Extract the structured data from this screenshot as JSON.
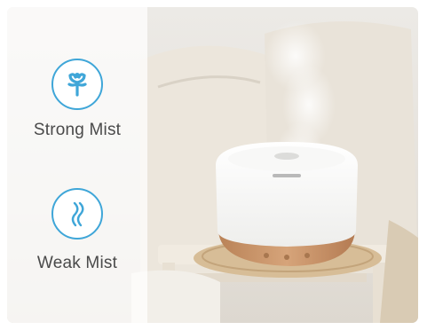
{
  "features": [
    {
      "label": "Strong Mist",
      "icon": "strong-mist-icon"
    },
    {
      "label": "Weak Mist",
      "icon": "weak-mist-icon"
    }
  ],
  "colors": {
    "accent": "#3fa6d8",
    "label_text": "#4a4a4a",
    "product_white": "#f6f6f4",
    "wood_base": "#c9936a"
  }
}
